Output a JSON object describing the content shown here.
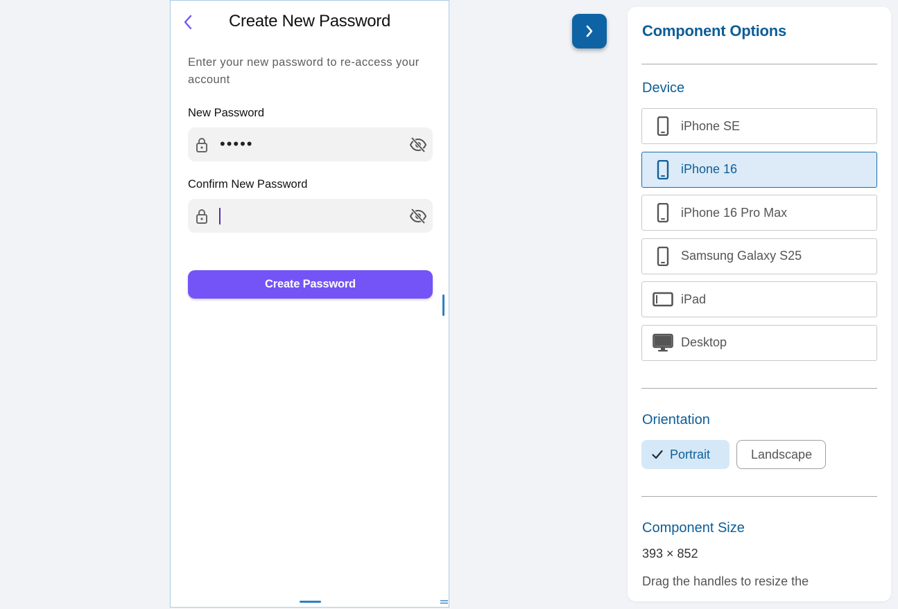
{
  "screen": {
    "title": "Create New Password",
    "subtitle": "Enter your new password to re-access your account",
    "new_password": {
      "label": "New Password",
      "value": "•••••"
    },
    "confirm_password": {
      "label": "Confirm New Password",
      "value": ""
    },
    "submit_label": "Create Password",
    "icons": {
      "back": "chevron-left-icon",
      "lock": "lock-icon",
      "visibility": "eye-off-icon"
    },
    "accent_color": "#7454f7"
  },
  "toggle": {
    "icon": "chevron-right-icon",
    "color": "#0e63a5"
  },
  "panel": {
    "title": "Component Options",
    "device": {
      "title": "Device",
      "items": [
        {
          "label": "iPhone SE",
          "icon": "phone-icon"
        },
        {
          "label": "iPhone 16",
          "icon": "phone-icon",
          "selected": true
        },
        {
          "label": "iPhone 16 Pro Max",
          "icon": "phone-icon"
        },
        {
          "label": "Samsung Galaxy S25",
          "icon": "phone-icon"
        },
        {
          "label": "iPad",
          "icon": "tablet-icon"
        },
        {
          "label": "Desktop",
          "icon": "desktop-icon"
        }
      ]
    },
    "orientation": {
      "title": "Orientation",
      "options": [
        {
          "label": "Portrait",
          "selected": true
        },
        {
          "label": "Landscape",
          "selected": false
        }
      ]
    },
    "size": {
      "title": "Component Size",
      "value": "393 × 852",
      "hint": "Drag the handles to resize the"
    },
    "accent_color": "#0d5d96"
  }
}
